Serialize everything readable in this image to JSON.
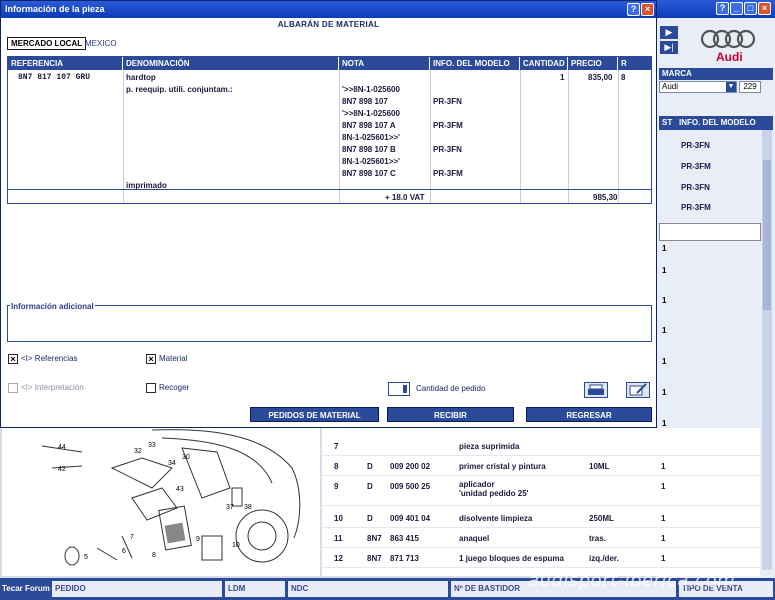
{
  "dialog": {
    "title": "Información de la pieza",
    "heading": "ALBARÁN DE MATERIAL",
    "tabs": [
      {
        "label": "MERCADO LOCAL"
      },
      {
        "label": "MEXICO"
      }
    ],
    "table": {
      "headers": [
        "REFERENCIA",
        "DENOMINACIÓN",
        "NOTA",
        "INFO. DEL MODELO",
        "CANTIDAD",
        "PRECIO",
        "R"
      ],
      "main_row": {
        "reference": "8N7 817 107     GRU",
        "denomination": "hardtop",
        "quantity": "1",
        "price": "835,00",
        "r": "8"
      },
      "sub_label": "p. reequip. utili. conjuntam.:",
      "notes": [
        {
          "nota": "'>>8N-1-025600",
          "model": ""
        },
        {
          "nota": "8N7 898 107",
          "model": "PR-3FN"
        },
        {
          "nota": "'>>8N-1-025600",
          "model": ""
        },
        {
          "nota": "8N7 898 107 A",
          "model": "PR-3FM"
        },
        {
          "nota": "8N-1-025601>>'",
          "model": ""
        },
        {
          "nota": "8N7 898 107 B",
          "model": "PR-3FN"
        },
        {
          "nota": "8N-1-025601>>'",
          "model": ""
        },
        {
          "nota": "8N7 898 107 C",
          "model": "PR-3FM"
        }
      ],
      "imprimado": "imprimado",
      "vat": "+ 18.0 VAT",
      "total": "985,30"
    },
    "info_label": "Información adicional",
    "options": {
      "referencias": "<I> Referencias",
      "material": "Material",
      "interpretacion": "<I> Interpretación",
      "recoger": "Recoger",
      "cantidad_pedido": "Cantidad de pedido"
    },
    "buttons": {
      "pedidos": "PEDIDOS DE MATERIAL",
      "recibir": "RECIBIR",
      "regresar": "REGRESAR"
    }
  },
  "right_panel": {
    "marca_label": "MARCA",
    "marca_value": "Audi",
    "marca_count": "229",
    "brand_text": "Audi",
    "header_st": "ST",
    "header_info": "INFO. DEL MODELO",
    "models": [
      "PR-3FN",
      "PR-3FM",
      "PR-3FN",
      "PR-3FM"
    ],
    "st_values": [
      "1",
      "1",
      "1",
      "1",
      "1",
      "1",
      "1",
      "1",
      "1",
      "1"
    ]
  },
  "parts": [
    {
      "pos": "7",
      "d": "",
      "num": "",
      "desc": "pieza suprimida",
      "unit": "",
      "qty": ""
    },
    {
      "pos": "8",
      "d": "D",
      "num": "009 200 02",
      "desc": "primer cristal y pintura",
      "unit": "10ML",
      "qty": "1"
    },
    {
      "pos": "9",
      "d": "D",
      "num": "009 500 25",
      "desc": "aplicador\n'unidad pedido 25'",
      "unit": "",
      "qty": "1"
    },
    {
      "pos": "10",
      "d": "D",
      "num": "009 401 04",
      "desc": "disolvente limpieza",
      "unit": "250ML",
      "qty": "1"
    },
    {
      "pos": "11",
      "d": "8N7",
      "num": "863 415",
      "desc": "anaquel",
      "unit": "tras.",
      "qty": "1"
    },
    {
      "pos": "12",
      "d": "8N7",
      "num": "871 713",
      "desc": "1 juego bloques de espuma",
      "unit": "izq./der.",
      "qty": "1"
    }
  ],
  "diagram_callouts": [
    "44",
    "42",
    "32",
    "33",
    "34",
    "30",
    "43",
    "37",
    "38",
    "6",
    "5",
    "8",
    "7",
    "9",
    "10"
  ],
  "statusbar": {
    "brand": "Tecar Forum",
    "fields": [
      "PEDIDO",
      "LDM",
      "NDC",
      "Nº DE BASTIDOR",
      "TIPO DE VENTA"
    ]
  },
  "watermark": "audisport-iberica.com",
  "colors": {
    "title_bar": "#0a3cb8",
    "accent": "#2b4a9a",
    "audi_red": "#cc0033"
  }
}
